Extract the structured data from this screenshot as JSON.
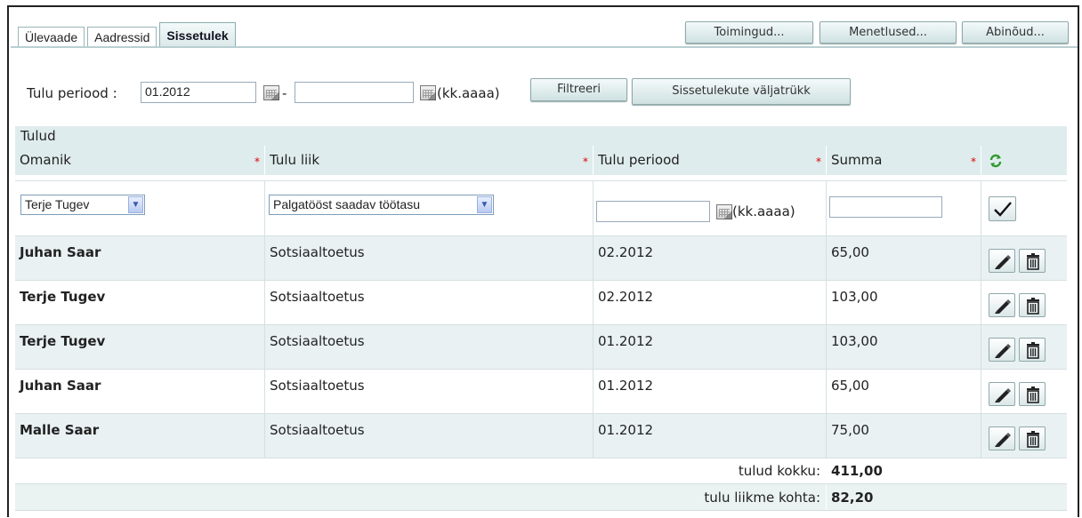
{
  "tabs": [
    {
      "label": "Ülevaade"
    },
    {
      "label": "Aadressid"
    },
    {
      "label": "Sissetulek"
    }
  ],
  "top_buttons": {
    "actions": "Toimingud...",
    "procedures": "Menetlused...",
    "aids": "Abinõud..."
  },
  "filter": {
    "label": "Tulu periood :",
    "from_value": "01.2012",
    "dash": "-",
    "to_value": "",
    "format_hint": "(kk.aaaa)",
    "filter_button": "Filtreeri",
    "print_button": "Sissetulekute väljatrükk"
  },
  "table": {
    "title": "Tulud",
    "columns": [
      "Omanik",
      "Tulu liik",
      "Tulu periood",
      "Summa"
    ],
    "required_mark": "*",
    "new_row": {
      "owner": "Terje Tugev",
      "type": "Palgatööst saadav töötasu",
      "period": "",
      "format_hint": "(kk.aaaa)",
      "amount": ""
    },
    "rows": [
      {
        "owner": "Juhan Saar",
        "type": "Sotsiaaltoetus",
        "period": "02.2012",
        "amount": "65,00"
      },
      {
        "owner": "Terje Tugev",
        "type": "Sotsiaaltoetus",
        "period": "02.2012",
        "amount": "103,00"
      },
      {
        "owner": "Terje Tugev",
        "type": "Sotsiaaltoetus",
        "period": "01.2012",
        "amount": "103,00"
      },
      {
        "owner": "Juhan Saar",
        "type": "Sotsiaaltoetus",
        "period": "01.2012",
        "amount": "65,00"
      },
      {
        "owner": "Malle Saar",
        "type": "Sotsiaaltoetus",
        "period": "01.2012",
        "amount": "75,00"
      }
    ],
    "totals": {
      "total_label": "tulud kokku:",
      "total_value": "411,00",
      "per_member_label": "tulu liikme kohta:",
      "per_member_value": "82,20"
    }
  },
  "colors": {
    "band": "#dfeced",
    "required": "#dd0000",
    "refresh_icon": "#2e9a2e"
  },
  "icons": [
    "calendar-icon",
    "refresh-icon",
    "checkmark-icon",
    "pencil-icon",
    "trash-icon",
    "chevron-down-icon"
  ]
}
